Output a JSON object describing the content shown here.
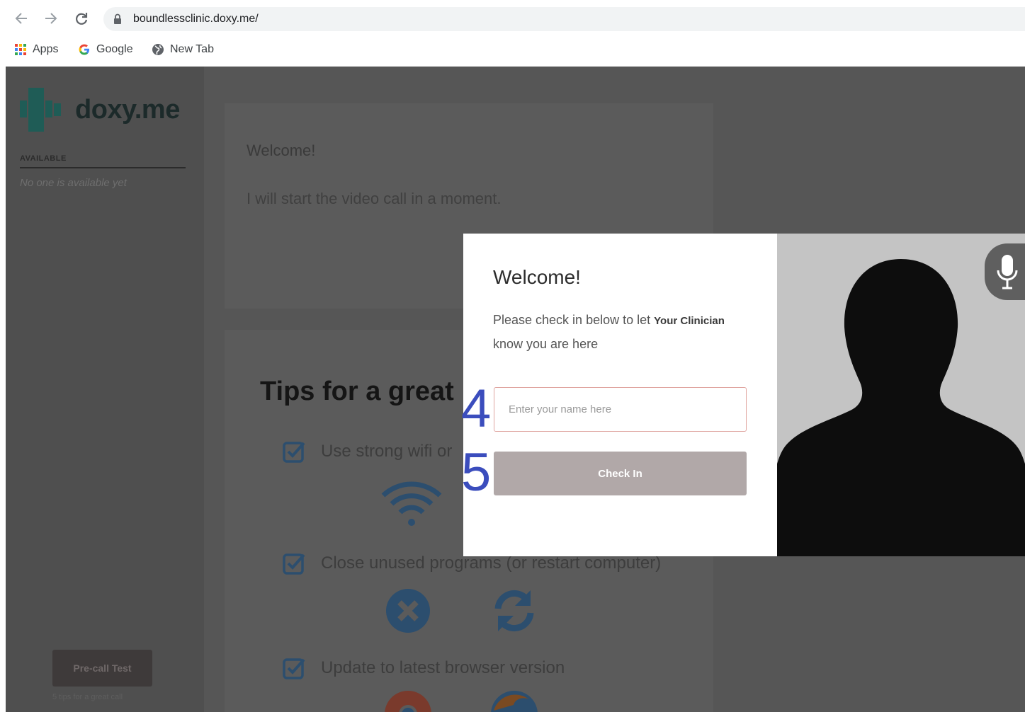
{
  "browser": {
    "url": "boundlessclinic.doxy.me/",
    "bookmarks": [
      {
        "label": "Apps",
        "icon": "apps-grid-icon"
      },
      {
        "label": "Google",
        "icon": "google-g-icon"
      },
      {
        "label": "New Tab",
        "icon": "globe-icon"
      }
    ]
  },
  "sidebar": {
    "logo_text": "doxy.me",
    "available_heading": "AVAILABLE",
    "available_empty": "No one is available yet",
    "precall_button": "Pre-call Test",
    "precall_link": "5 tips for a great call"
  },
  "welcome_card": {
    "title": "Welcome!",
    "message": "I will start the video call in a moment."
  },
  "tips": {
    "title": "Tips for a great call",
    "items": [
      {
        "label": "Use strong wifi or"
      },
      {
        "label": "Close unused programs (or restart computer)"
      },
      {
        "label": "Update to latest browser version"
      }
    ]
  },
  "modal": {
    "title": "Welcome!",
    "text_before": "Please check in below to let",
    "clinician": "Your Clinician",
    "text_after": "know you are here",
    "input_placeholder": "Enter your name here",
    "input_value": "",
    "button_label": "Check In"
  },
  "annotations": {
    "step_input": "4",
    "step_button": "5"
  },
  "colors": {
    "overlay": "#565656",
    "brand_teal": "#1f5c56",
    "accent_blue": "#2c4e6e",
    "checkin_button": "#b1a8a8",
    "annotation": "#3b4dbd"
  }
}
